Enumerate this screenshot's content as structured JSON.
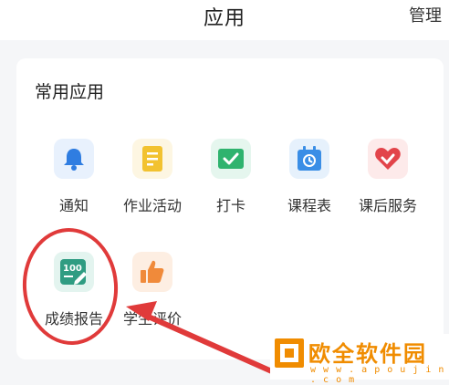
{
  "header": {
    "title": "应用",
    "manage_label": "管理"
  },
  "section": {
    "title": "常用应用"
  },
  "apps": [
    {
      "label": "通知",
      "icon": "bell-icon",
      "color": "#2f7de1",
      "bg": "#e8f1fd"
    },
    {
      "label": "作业活动",
      "icon": "homework-doc-icon",
      "color": "#f2c230",
      "bg": "#fdf6e2"
    },
    {
      "label": "打卡",
      "icon": "checkin-icon",
      "color": "#2fb36e",
      "bg": "#e5f6ee"
    },
    {
      "label": "课程表",
      "icon": "schedule-calendar-icon",
      "color": "#3a8ee6",
      "bg": "#e6f1fc"
    },
    {
      "label": "课后服务",
      "icon": "after-school-heart-icon",
      "color": "#e2444a",
      "bg": "#fdeaea"
    },
    {
      "label": "成绩报告",
      "icon": "score-report-icon",
      "color": "#2f9c82",
      "bg": "#e3f4ef",
      "icon_text": "100"
    },
    {
      "label": "学生评价",
      "icon": "thumbs-up-icon",
      "color": "#f08a3a",
      "bg": "#fdeee2"
    }
  ],
  "watermark": {
    "text": "欧全软件园",
    "url": "w w w . a p o u j i n . c o m"
  },
  "annotation_color": "#e03a3a"
}
